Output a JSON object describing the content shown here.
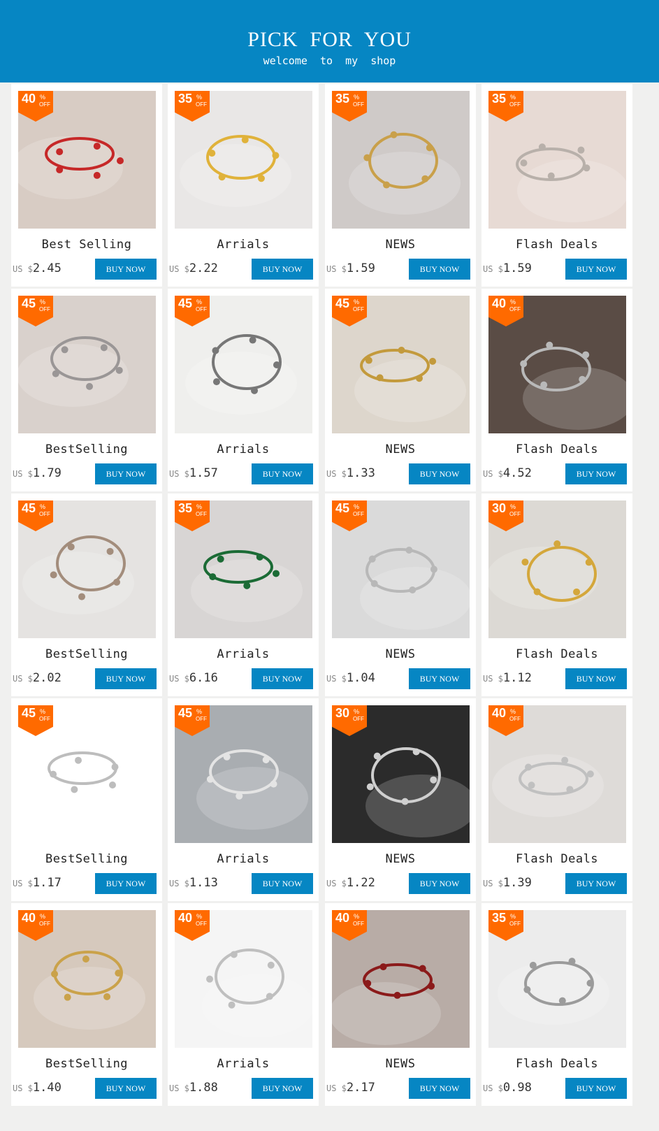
{
  "header": {
    "title": "PICK  FOR  YOU",
    "subtitle": "welcome  to  my  shop"
  },
  "colors": {
    "brand": "#0686c3",
    "badge": "#ff6a00",
    "background": "#f0f0ef"
  },
  "badge_pct_symbol": "%",
  "badge_off_label": "OFF",
  "currency_label": "US $",
  "buy_label": "BUY NOW",
  "products": [
    {
      "discount": "40",
      "name": "Best Selling",
      "price": "2.45",
      "image": "red-string-bracelets",
      "bg": "#d8ccc4",
      "fg": "#c62828"
    },
    {
      "discount": "35",
      "name": "Arrials",
      "price": "2.22",
      "image": "daisy-bracelet",
      "bg": "#e9e7e6",
      "fg": "#e0b23a"
    },
    {
      "discount": "35",
      "name": "NEWS",
      "price": "1.59",
      "image": "butterfly-bracelet",
      "bg": "#cfcac8",
      "fg": "#c9a04a"
    },
    {
      "discount": "35",
      "name": "Flash Deals",
      "price": "1.59",
      "image": "wrist-bracelet",
      "bg": "#e7dad4",
      "fg": "#b8b0aa"
    },
    {
      "discount": "45",
      "name": "BestSelling",
      "price": "1.79",
      "image": "thin-chain-bracelet",
      "bg": "#d9d1cc",
      "fg": "#9a9696"
    },
    {
      "discount": "45",
      "name": "Arrials",
      "price": "1.57",
      "image": "bead-bracelet",
      "bg": "#efefed",
      "fg": "#777777"
    },
    {
      "discount": "45",
      "name": "NEWS",
      "price": "1.33",
      "image": "coin-charm-bracelet",
      "bg": "#ddd6cc",
      "fg": "#c39a3c"
    },
    {
      "discount": "40",
      "name": "Flash Deals",
      "price": "4.52",
      "image": "braided-cuff",
      "bg": "#5a4c45",
      "fg": "#b9b9b9"
    },
    {
      "discount": "45",
      "name": "BestSelling",
      "price": "2.02",
      "image": "bracelet-set-collage",
      "bg": "#e5e3e1",
      "fg": "#a38d7c"
    },
    {
      "discount": "35",
      "name": "Arrials",
      "price": "6.16",
      "image": "green-bead-bracelet",
      "bg": "#d8d5d4",
      "fg": "#1b6b35"
    },
    {
      "discount": "45",
      "name": "NEWS",
      "price": "1.04",
      "image": "hug-ring",
      "bg": "#dadada",
      "fg": "#b8b8b8"
    },
    {
      "discount": "30",
      "name": "Flash Deals",
      "price": "1.12",
      "image": "couple-rings",
      "bg": "#dcd9d4",
      "fg": "#d4a73b"
    },
    {
      "discount": "45",
      "name": "BestSelling",
      "price": "1.17",
      "image": "dolphin-ring",
      "bg": "#ffffff",
      "fg": "#bdbdbd"
    },
    {
      "discount": "45",
      "name": "Arrials",
      "price": "1.13",
      "image": "leaf-ring",
      "bg": "#a9adb1",
      "fg": "#e4e4e4"
    },
    {
      "discount": "30",
      "name": "NEWS",
      "price": "1.22",
      "image": "rings-on-hand",
      "bg": "#2b2b2b",
      "fg": "#cfcfcf"
    },
    {
      "discount": "40",
      "name": "Flash Deals",
      "price": "1.39",
      "image": "heart-chain-ring",
      "bg": "#dedbd8",
      "fg": "#c0c0c0"
    },
    {
      "discount": "40",
      "name": "BestSelling",
      "price": "1.40",
      "image": "stacked-gold-rings",
      "bg": "#d6c9bd",
      "fg": "#caa24a"
    },
    {
      "discount": "40",
      "name": "Arrials",
      "price": "1.88",
      "image": "sun-moon-rings",
      "bg": "#f5f5f5",
      "fg": "#bfbfbf"
    },
    {
      "discount": "40",
      "name": "NEWS",
      "price": "2.17",
      "image": "red-rose-rings",
      "bg": "#b8aca6",
      "fg": "#8b1a1a"
    },
    {
      "discount": "35",
      "name": "Flash Deals",
      "price": "0.98",
      "image": "ring-set-collage",
      "bg": "#ececec",
      "fg": "#9b9b9b"
    }
  ]
}
